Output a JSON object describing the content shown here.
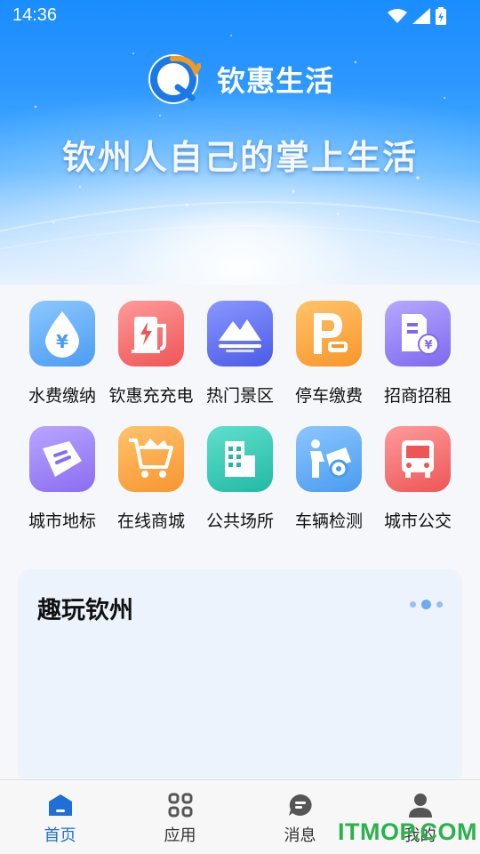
{
  "status": {
    "time": "14:36"
  },
  "brand": {
    "name": "钦惠生活",
    "slogan": "钦州人自己的掌上生活"
  },
  "services": [
    {
      "label": "水费缴纳",
      "icon": "water-drop-yuan-icon",
      "color": "#5aa8f5"
    },
    {
      "label": "钦惠充充电",
      "icon": "charging-station-icon",
      "color": "#f46b6b"
    },
    {
      "label": "热门景区",
      "icon": "mountains-icon",
      "color": "#5a6cf0"
    },
    {
      "label": "停车缴费",
      "icon": "parking-icon",
      "color": "#f7a23a"
    },
    {
      "label": "招商招租",
      "icon": "building-yuan-icon",
      "color": "#8f7cf2"
    },
    {
      "label": "城市地标",
      "icon": "ticket-icon",
      "color": "#9a7df0"
    },
    {
      "label": "在线商城",
      "icon": "shopping-cart-icon",
      "color": "#f9a13c"
    },
    {
      "label": "公共场所",
      "icon": "office-building-icon",
      "color": "#2fc9b4"
    },
    {
      "label": "车辆检测",
      "icon": "car-inspection-icon",
      "color": "#4fa6f0"
    },
    {
      "label": "城市公交",
      "icon": "bus-icon",
      "color": "#f26a6a"
    }
  ],
  "card": {
    "title": "趣玩钦州"
  },
  "tabs": [
    {
      "label": "首页",
      "icon": "home-icon",
      "active": true
    },
    {
      "label": "应用",
      "icon": "apps-grid-icon",
      "active": false
    },
    {
      "label": "消息",
      "icon": "message-icon",
      "active": false
    },
    {
      "label": "我的",
      "icon": "user-icon",
      "active": false
    }
  ],
  "watermark": "ITMOP.COM"
}
